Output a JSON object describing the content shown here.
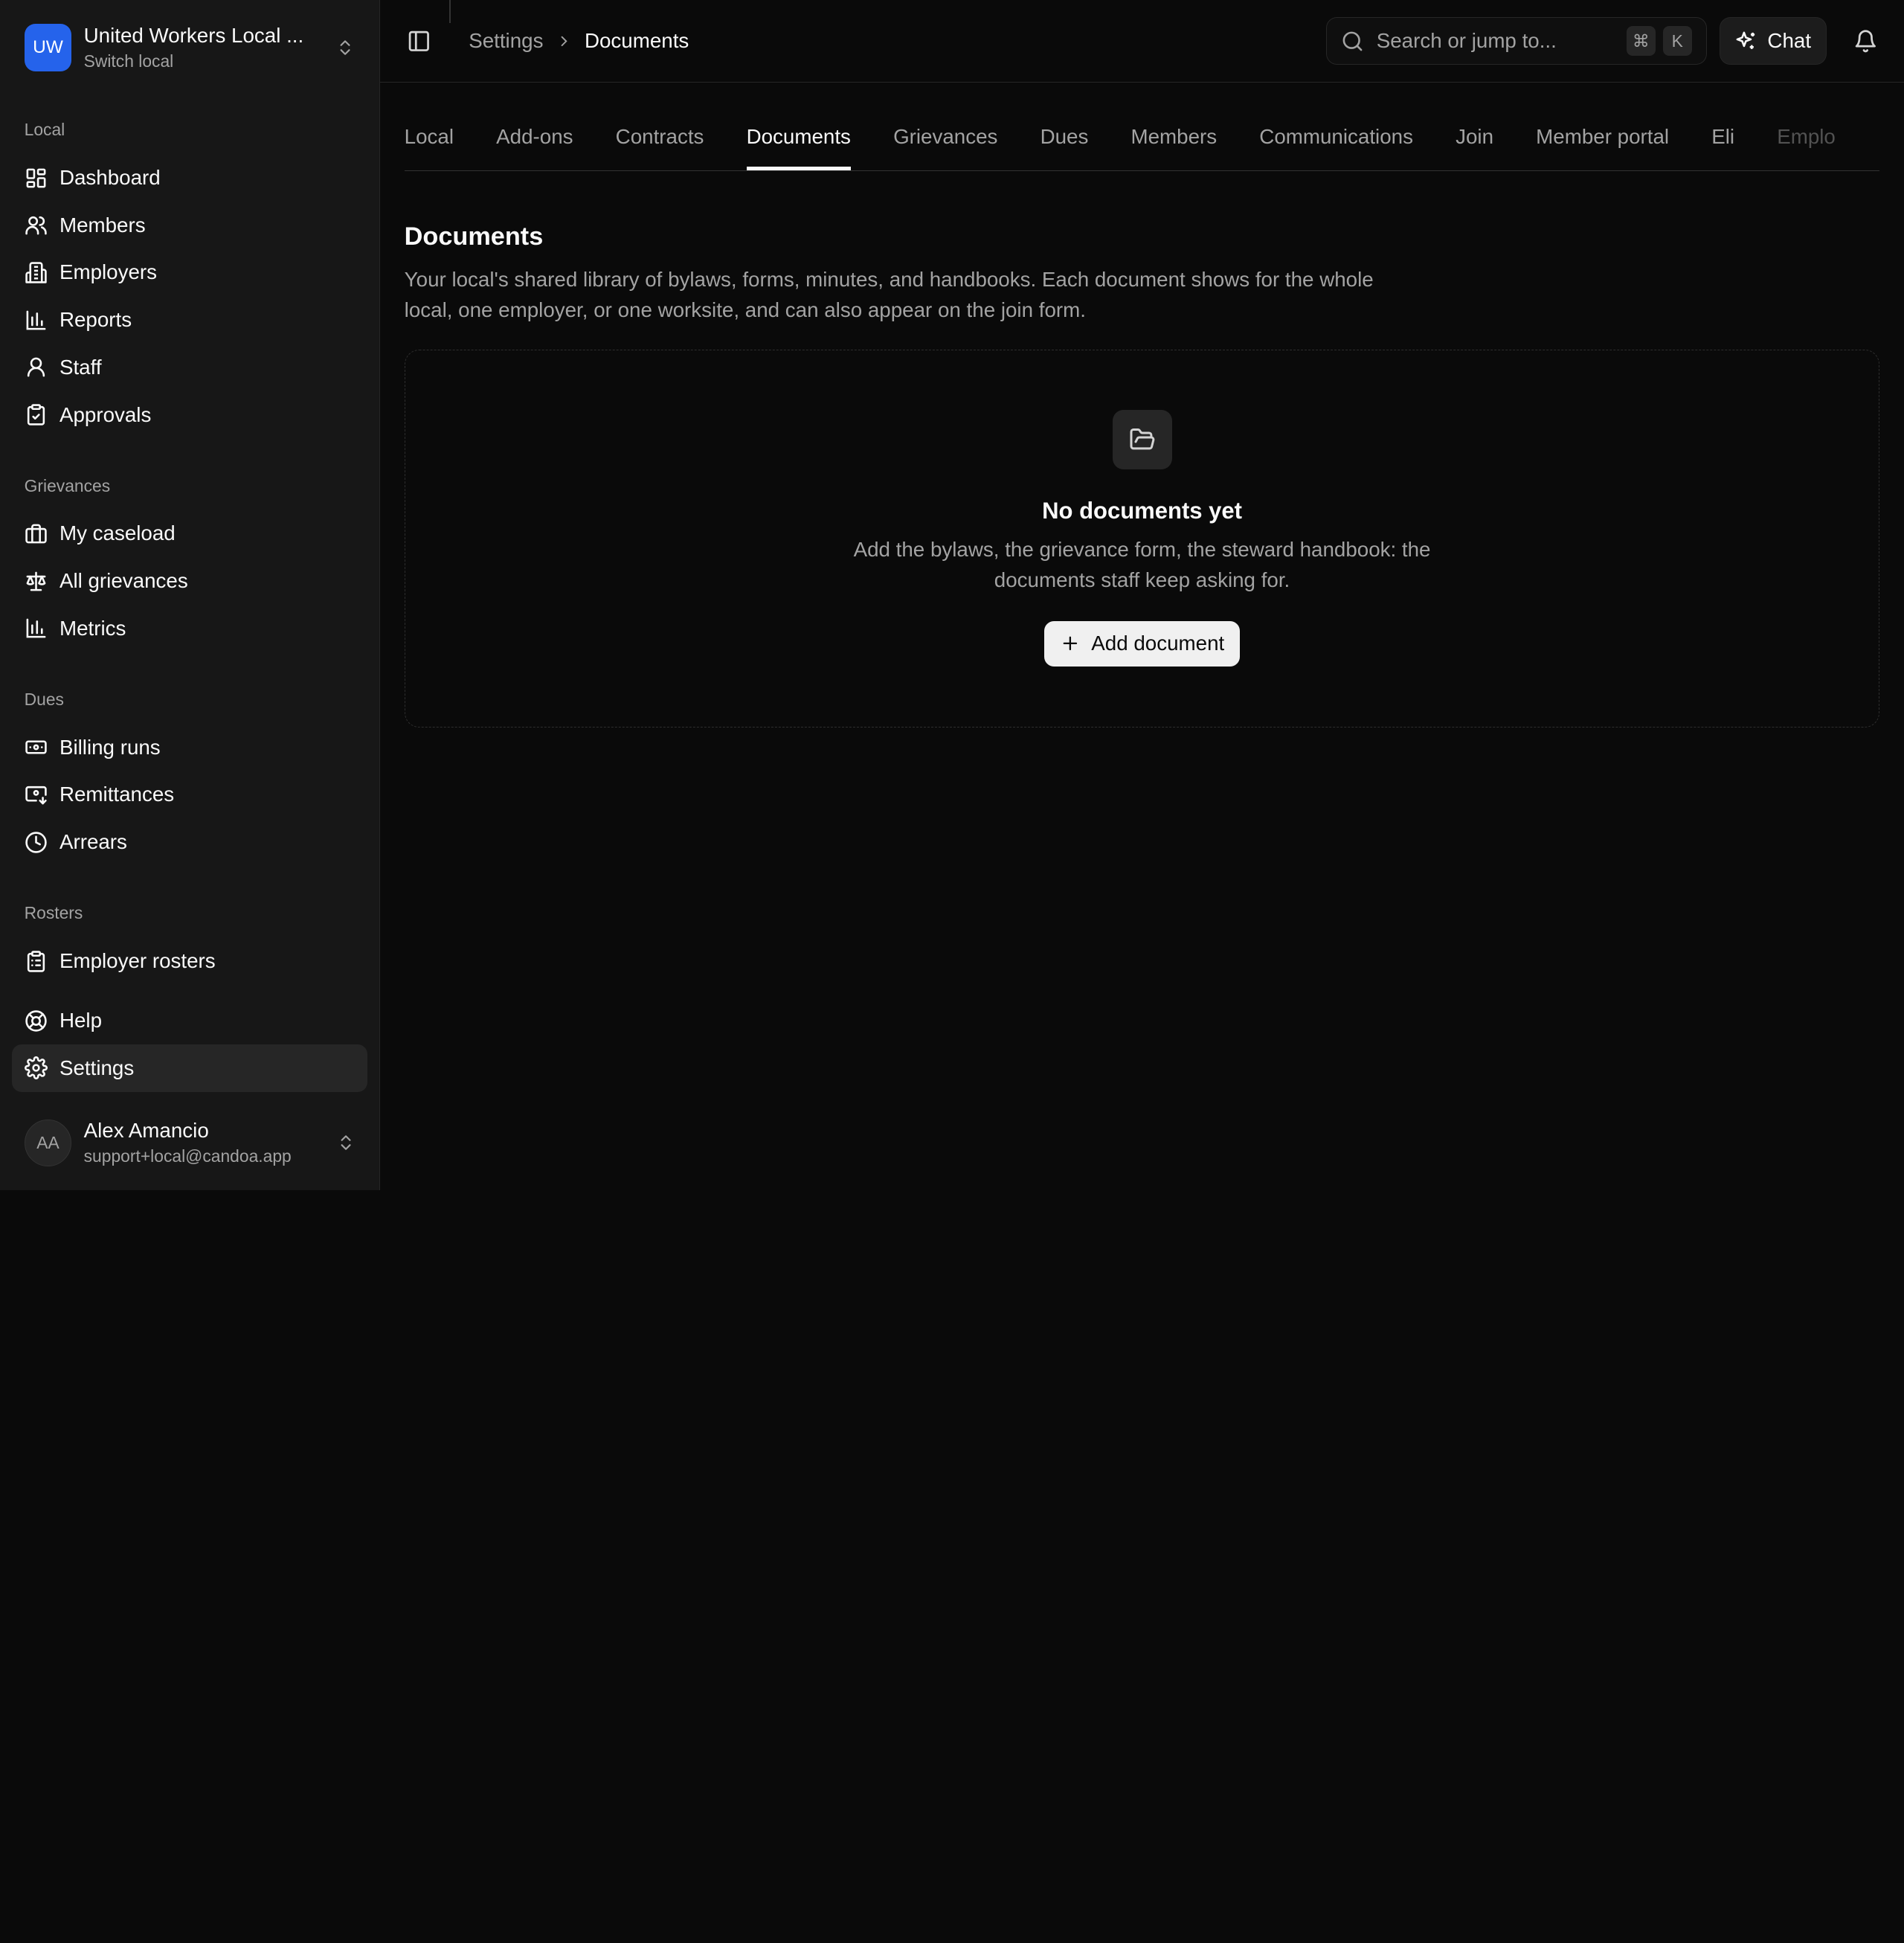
{
  "local": {
    "badge": "UW",
    "name": "United Workers Local ...",
    "subtitle": "Switch local"
  },
  "sidebar": {
    "sections": [
      {
        "label": "Local",
        "items": [
          "Dashboard",
          "Members",
          "Employers",
          "Reports",
          "Staff",
          "Approvals"
        ]
      },
      {
        "label": "Grievances",
        "items": [
          "My caseload",
          "All grievances",
          "Metrics"
        ]
      },
      {
        "label": "Dues",
        "items": [
          "Billing runs",
          "Remittances",
          "Arrears"
        ]
      },
      {
        "label": "Rosters",
        "items": [
          "Employer rosters"
        ]
      }
    ],
    "help": "Help",
    "settings": "Settings"
  },
  "user": {
    "initials": "AA",
    "name": "Alex Amancio",
    "email": "support+local@candoa.app"
  },
  "breadcrumb": {
    "parent": "Settings",
    "current": "Documents"
  },
  "search": {
    "placeholder": "Search or jump to...",
    "key1": "⌘",
    "key2": "K"
  },
  "chat": {
    "label": "Chat"
  },
  "tabs": [
    "Local",
    "Add-ons",
    "Contracts",
    "Documents",
    "Grievances",
    "Dues",
    "Members",
    "Communications",
    "Join",
    "Member portal",
    "Eli",
    "Emplo"
  ],
  "active_tab": "Documents",
  "page": {
    "title": "Documents",
    "description": "Your local's shared library of bylaws, forms, minutes, and handbooks. Each document shows for the whole local, one employer, or one worksite, and can also appear on the join form."
  },
  "empty_state": {
    "title": "No documents yet",
    "description": "Add the bylaws, the grievance form, the steward handbook: the documents staff keep asking for.",
    "button": "Add document"
  }
}
